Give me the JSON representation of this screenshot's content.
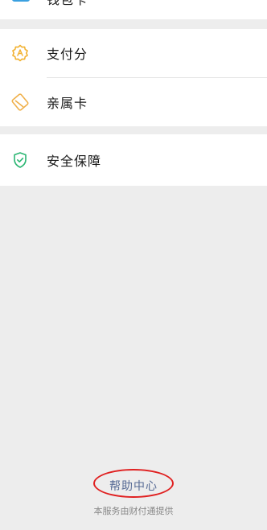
{
  "top_row": {
    "label": "钱包卡"
  },
  "payment_group": {
    "items": [
      {
        "label": "支付分",
        "icon": "payscore-icon",
        "icon_color": "#f2b233"
      },
      {
        "label": "亲属卡",
        "icon": "family-card-icon",
        "icon_color": "#f0b04a"
      }
    ]
  },
  "security_group": {
    "items": [
      {
        "label": "安全保障",
        "icon": "shield-icon",
        "icon_color": "#2bb673"
      }
    ]
  },
  "footer": {
    "help_label": "帮助中心",
    "provider_text": "本服务由财付通提供",
    "help_color": "#576b95"
  }
}
